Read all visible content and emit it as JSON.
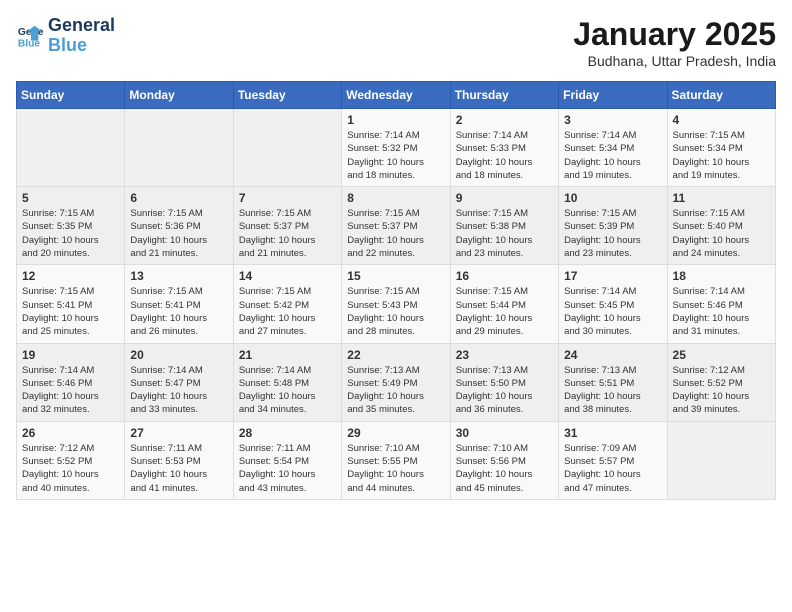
{
  "header": {
    "logo_line1": "General",
    "logo_line2": "Blue",
    "month": "January 2025",
    "location": "Budhana, Uttar Pradesh, India"
  },
  "weekdays": [
    "Sunday",
    "Monday",
    "Tuesday",
    "Wednesday",
    "Thursday",
    "Friday",
    "Saturday"
  ],
  "weeks": [
    [
      {
        "day": "",
        "info": ""
      },
      {
        "day": "",
        "info": ""
      },
      {
        "day": "",
        "info": ""
      },
      {
        "day": "1",
        "info": "Sunrise: 7:14 AM\nSunset: 5:32 PM\nDaylight: 10 hours\nand 18 minutes."
      },
      {
        "day": "2",
        "info": "Sunrise: 7:14 AM\nSunset: 5:33 PM\nDaylight: 10 hours\nand 18 minutes."
      },
      {
        "day": "3",
        "info": "Sunrise: 7:14 AM\nSunset: 5:34 PM\nDaylight: 10 hours\nand 19 minutes."
      },
      {
        "day": "4",
        "info": "Sunrise: 7:15 AM\nSunset: 5:34 PM\nDaylight: 10 hours\nand 19 minutes."
      }
    ],
    [
      {
        "day": "5",
        "info": "Sunrise: 7:15 AM\nSunset: 5:35 PM\nDaylight: 10 hours\nand 20 minutes."
      },
      {
        "day": "6",
        "info": "Sunrise: 7:15 AM\nSunset: 5:36 PM\nDaylight: 10 hours\nand 21 minutes."
      },
      {
        "day": "7",
        "info": "Sunrise: 7:15 AM\nSunset: 5:37 PM\nDaylight: 10 hours\nand 21 minutes."
      },
      {
        "day": "8",
        "info": "Sunrise: 7:15 AM\nSunset: 5:37 PM\nDaylight: 10 hours\nand 22 minutes."
      },
      {
        "day": "9",
        "info": "Sunrise: 7:15 AM\nSunset: 5:38 PM\nDaylight: 10 hours\nand 23 minutes."
      },
      {
        "day": "10",
        "info": "Sunrise: 7:15 AM\nSunset: 5:39 PM\nDaylight: 10 hours\nand 23 minutes."
      },
      {
        "day": "11",
        "info": "Sunrise: 7:15 AM\nSunset: 5:40 PM\nDaylight: 10 hours\nand 24 minutes."
      }
    ],
    [
      {
        "day": "12",
        "info": "Sunrise: 7:15 AM\nSunset: 5:41 PM\nDaylight: 10 hours\nand 25 minutes."
      },
      {
        "day": "13",
        "info": "Sunrise: 7:15 AM\nSunset: 5:41 PM\nDaylight: 10 hours\nand 26 minutes."
      },
      {
        "day": "14",
        "info": "Sunrise: 7:15 AM\nSunset: 5:42 PM\nDaylight: 10 hours\nand 27 minutes."
      },
      {
        "day": "15",
        "info": "Sunrise: 7:15 AM\nSunset: 5:43 PM\nDaylight: 10 hours\nand 28 minutes."
      },
      {
        "day": "16",
        "info": "Sunrise: 7:15 AM\nSunset: 5:44 PM\nDaylight: 10 hours\nand 29 minutes."
      },
      {
        "day": "17",
        "info": "Sunrise: 7:14 AM\nSunset: 5:45 PM\nDaylight: 10 hours\nand 30 minutes."
      },
      {
        "day": "18",
        "info": "Sunrise: 7:14 AM\nSunset: 5:46 PM\nDaylight: 10 hours\nand 31 minutes."
      }
    ],
    [
      {
        "day": "19",
        "info": "Sunrise: 7:14 AM\nSunset: 5:46 PM\nDaylight: 10 hours\nand 32 minutes."
      },
      {
        "day": "20",
        "info": "Sunrise: 7:14 AM\nSunset: 5:47 PM\nDaylight: 10 hours\nand 33 minutes."
      },
      {
        "day": "21",
        "info": "Sunrise: 7:14 AM\nSunset: 5:48 PM\nDaylight: 10 hours\nand 34 minutes."
      },
      {
        "day": "22",
        "info": "Sunrise: 7:13 AM\nSunset: 5:49 PM\nDaylight: 10 hours\nand 35 minutes."
      },
      {
        "day": "23",
        "info": "Sunrise: 7:13 AM\nSunset: 5:50 PM\nDaylight: 10 hours\nand 36 minutes."
      },
      {
        "day": "24",
        "info": "Sunrise: 7:13 AM\nSunset: 5:51 PM\nDaylight: 10 hours\nand 38 minutes."
      },
      {
        "day": "25",
        "info": "Sunrise: 7:12 AM\nSunset: 5:52 PM\nDaylight: 10 hours\nand 39 minutes."
      }
    ],
    [
      {
        "day": "26",
        "info": "Sunrise: 7:12 AM\nSunset: 5:52 PM\nDaylight: 10 hours\nand 40 minutes."
      },
      {
        "day": "27",
        "info": "Sunrise: 7:11 AM\nSunset: 5:53 PM\nDaylight: 10 hours\nand 41 minutes."
      },
      {
        "day": "28",
        "info": "Sunrise: 7:11 AM\nSunset: 5:54 PM\nDaylight: 10 hours\nand 43 minutes."
      },
      {
        "day": "29",
        "info": "Sunrise: 7:10 AM\nSunset: 5:55 PM\nDaylight: 10 hours\nand 44 minutes."
      },
      {
        "day": "30",
        "info": "Sunrise: 7:10 AM\nSunset: 5:56 PM\nDaylight: 10 hours\nand 45 minutes."
      },
      {
        "day": "31",
        "info": "Sunrise: 7:09 AM\nSunset: 5:57 PM\nDaylight: 10 hours\nand 47 minutes."
      },
      {
        "day": "",
        "info": ""
      }
    ]
  ]
}
